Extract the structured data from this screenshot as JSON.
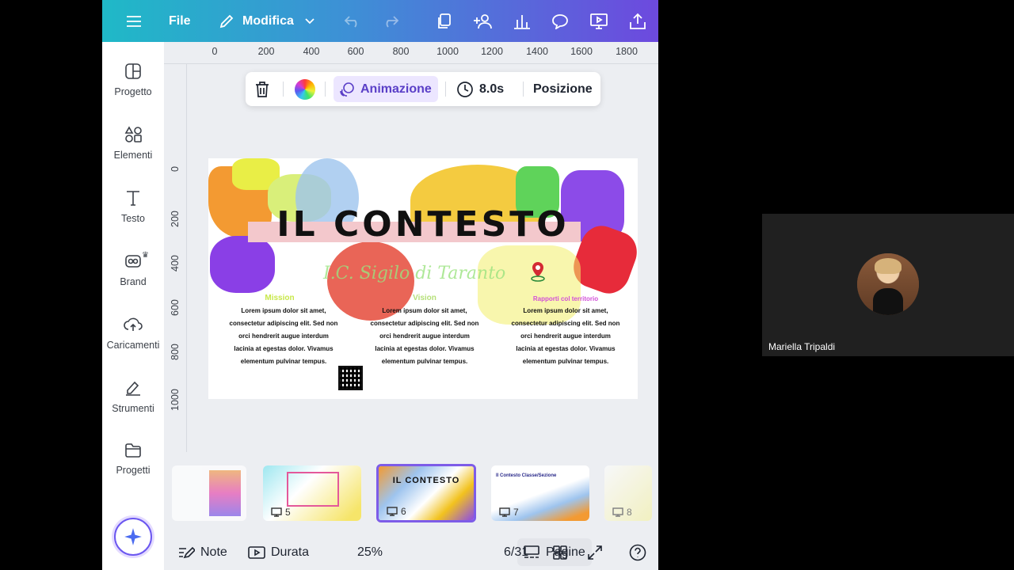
{
  "topbar": {
    "file_label": "File",
    "edit_label": "Modifica"
  },
  "ruler": {
    "top_labels": [
      "0",
      "200",
      "400",
      "600",
      "800",
      "1000",
      "1200",
      "1400",
      "1600",
      "1800"
    ],
    "left_labels": [
      "0",
      "200",
      "400",
      "600",
      "800",
      "1000"
    ]
  },
  "context_bar": {
    "animation_label": "Animazione",
    "duration_label": "8.0s",
    "position_label": "Posizione"
  },
  "sidebar": {
    "items": [
      {
        "label": "Progetto",
        "icon": "layout-icon"
      },
      {
        "label": "Elementi",
        "icon": "shapes-icon"
      },
      {
        "label": "Testo",
        "icon": "text-icon"
      },
      {
        "label": "Brand",
        "icon": "brand-icon"
      },
      {
        "label": "Caricamenti",
        "icon": "upload-cloud-icon"
      },
      {
        "label": "Strumenti",
        "icon": "draw-icon"
      },
      {
        "label": "Progetti",
        "icon": "folder-icon"
      }
    ]
  },
  "slide": {
    "title": "IL CONTESTO",
    "subtitle": "I.C. Sigilo di Taranto",
    "columns": [
      {
        "heading": "Mission",
        "heading_color": "#c8e84a",
        "body": "Lorem ipsum dolor sit amet, consectetur adipiscing elit. Sed non orci hendrerit augue interdum lacinia at egestas dolor. Vivamus elementum pulvinar tempus."
      },
      {
        "heading": "Vision",
        "heading_color": "#b6e07a",
        "body": "Lorem ipsum dolor sit amet, consectetur adipiscing elit. Sed non orci hendrerit augue interdum lacinia at egestas dolor. Vivamus elementum pulvinar tempus."
      },
      {
        "heading": "Rapporti col territorio",
        "heading_color": "#d24fd8",
        "body": "Lorem ipsum dolor sit amet, consectetur adipiscing elit. Sed non orci hendrerit augue interdum lacinia at egestas dolor. Vivamus elementum pulvinar tempus."
      }
    ]
  },
  "thumbnails": [
    {
      "number": ""
    },
    {
      "number": "5"
    },
    {
      "number": "6",
      "title": "IL CONTESTO"
    },
    {
      "number": "7",
      "title": "Il Contesto Classe/Sezione"
    },
    {
      "number": "8"
    }
  ],
  "bottombar": {
    "notes_label": "Note",
    "duration_label": "Durata",
    "zoom": "25%",
    "pages_label": "Pagine",
    "page_counter": "6/31"
  },
  "video": {
    "participant_name": "Mariella Tripaldi"
  },
  "colors": {
    "topbar_start": "#1fb9c7",
    "topbar_end": "#6d49de",
    "accent": "#7d5ce8"
  }
}
